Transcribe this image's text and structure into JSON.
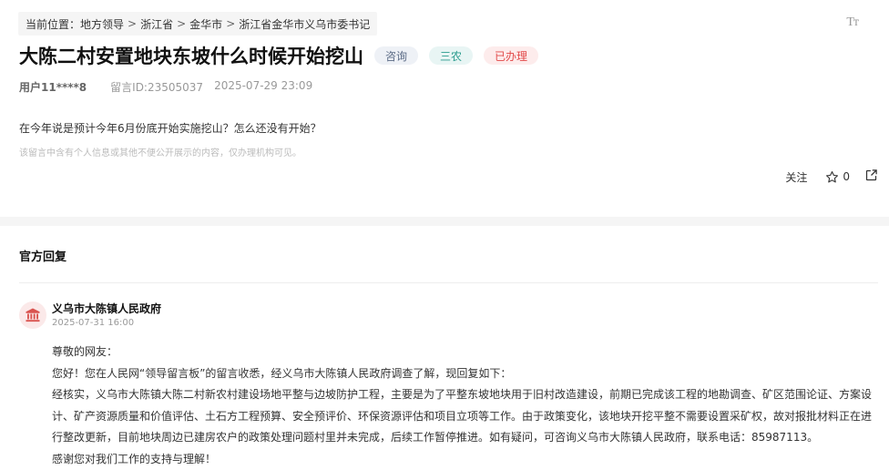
{
  "breadcrumb": {
    "prefix": "当前位置：",
    "items": [
      "地方领导",
      "浙江省",
      "金华市",
      "浙江省金华市义乌市委书记"
    ],
    "separator": ">"
  },
  "font_size_icon": "Tт",
  "post": {
    "title": "大陈二村安置地块东坡什么时候开始挖山",
    "tags": [
      "咨询",
      "三农",
      "已办理"
    ],
    "user": "用户11****8",
    "message_id": "留言ID:23505037",
    "datetime": "2025-07-29 23:09",
    "question": "在今年说是预计今年6月份底开始实施挖山？怎么还没有开始？",
    "privacy_note": "该留言中含有个人信息或其他不便公开展示的内容，仅办理机构可见。"
  },
  "actions": {
    "follow_label": "关注",
    "star_count": "0"
  },
  "reply_section": {
    "title": "官方回复",
    "org_name": "义乌市大陈镇人民政府",
    "org_date": "2025-07-31 16:00",
    "paragraphs": [
      "尊敬的网友：",
      "您好！您在人民网“领导留言板”的留言收悉，经义乌市大陈镇人民政府调查了解，现回复如下：",
      "经核实，义乌市大陈镇大陈二村新农村建设场地平整与边坡防护工程，主要是为了平整东坡地块用于旧村改造建设，前期已完成该工程的地勘调查、矿区范围论证、方案设计、矿产资源质量和价值评估、土石方工程预算、安全预评价、环保资源评估和项目立项等工作。由于政策变化，该地块开挖平整不需要设置采矿权，故对报批材料正在进行整改更新，目前地块周边已建房农户的政策处理问题村里并未完成，后续工作暂停推进。如有疑问，可咨询义乌市大陈镇人民政府，联系电话：85987113。",
      "感谢您对我们工作的支持与理解！"
    ]
  },
  "colors": {
    "tag_consult_bg": "#eef1f6",
    "tag_sannong_bg": "#e8f5f4",
    "tag_done_text": "#e24a4a",
    "avatar_icon": "#d9534f"
  },
  "icons": {
    "star": "star-icon",
    "share": "share-icon",
    "avatar": "government-building-icon"
  }
}
